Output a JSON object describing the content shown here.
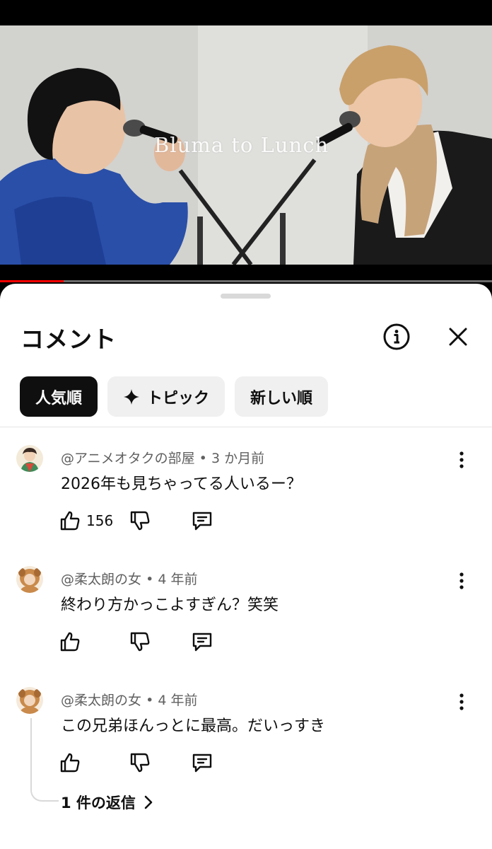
{
  "video": {
    "overlay_title": "Bluma to Lunch",
    "progress": 0.13
  },
  "sheet": {
    "title": "コメント",
    "info_icon": "info-icon",
    "close_icon": "close-icon"
  },
  "chips": [
    {
      "label": "人気順",
      "active": true
    },
    {
      "label": "トピック",
      "icon": "sparkle-icon",
      "active": false
    },
    {
      "label": "新しい順",
      "active": false
    }
  ],
  "comments": [
    {
      "author": "@アニメオタクの部屋",
      "time": "3 か月前",
      "separator": "•",
      "text": "2026年も見ちゃってる人いるー？",
      "likes": "156"
    },
    {
      "author": "@柔太朗の女",
      "time": "4 年前",
      "separator": "•",
      "text": "終わり方かっこよすぎん？笑笑",
      "likes": ""
    },
    {
      "author": "@柔太朗の女",
      "time": "4 年前",
      "separator": "•",
      "text": "この兄弟ほんっとに最高。だいっすき",
      "likes": "",
      "replies": "1 件の返信"
    }
  ],
  "colors": {
    "accent": "#0f0f0f",
    "chip_bg": "#f0f0f0",
    "meta_text": "#606060",
    "progress": "#ff0000"
  }
}
